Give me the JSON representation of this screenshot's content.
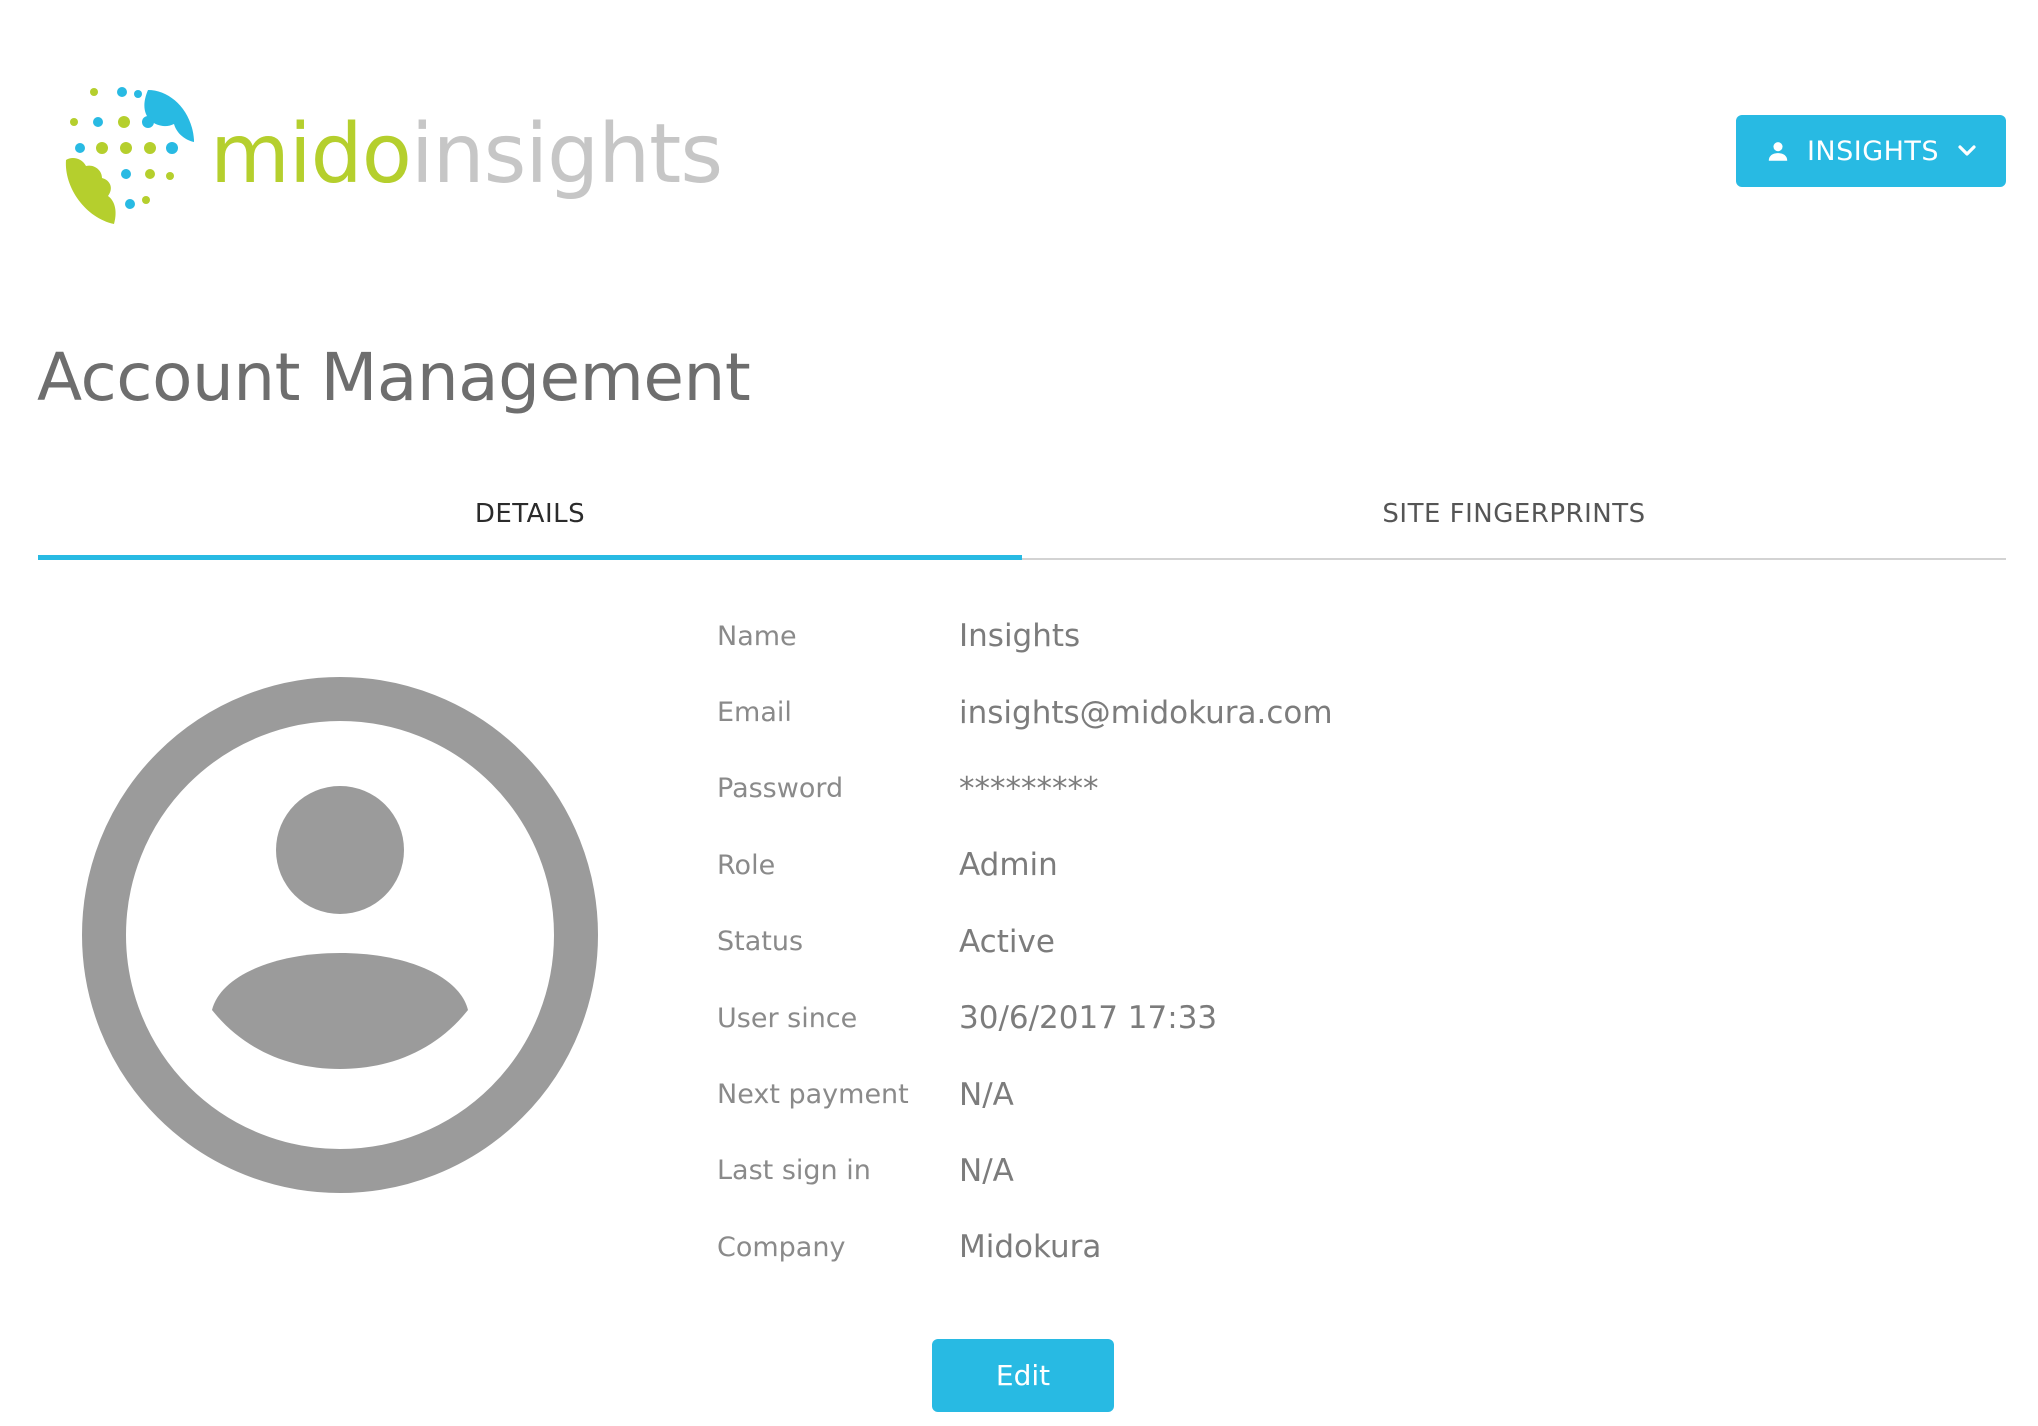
{
  "logo": {
    "name_part1": "mido",
    "name_part2": "insights",
    "color_primary": "#b5cf2d",
    "color_secondary": "#c6c6c6",
    "color_accent": "#28bae3"
  },
  "header": {
    "user_menu": {
      "label": "INSIGHTS",
      "icon": "person-icon",
      "dropdown_icon": "chevron-down-icon",
      "color": "#28bae3"
    }
  },
  "page": {
    "title": "Account Management"
  },
  "tabs": [
    {
      "label": "DETAILS",
      "active": true
    },
    {
      "label": "SITE FINGERPRINTS",
      "active": false
    }
  ],
  "avatar": {
    "icon": "account-circle-icon",
    "color": "#9b9b9b"
  },
  "details": {
    "rows": [
      {
        "label": "Name",
        "value": "Insights"
      },
      {
        "label": "Email",
        "value": "insights@midokura.com"
      },
      {
        "label": "Password",
        "value": "*********"
      },
      {
        "label": "Role",
        "value": "Admin"
      },
      {
        "label": "Status",
        "value": "Active"
      },
      {
        "label": "User since",
        "value": "30/6/2017 17:33"
      },
      {
        "label": "Next payment",
        "value": "N/A"
      },
      {
        "label": "Last sign in",
        "value": "N/A"
      },
      {
        "label": "Company",
        "value": "Midokura"
      }
    ]
  },
  "actions": {
    "edit_label": "Edit"
  }
}
